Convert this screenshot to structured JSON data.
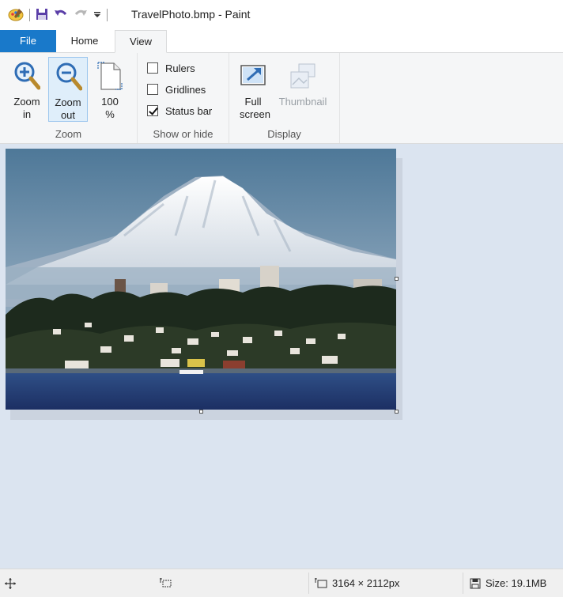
{
  "window": {
    "title": "TravelPhoto.bmp - Paint"
  },
  "quick_access": {
    "icons": [
      "paint-app-icon",
      "save-icon",
      "undo-icon",
      "redo-icon",
      "customize-qat-icon"
    ]
  },
  "tabs": [
    {
      "label": "File"
    },
    {
      "label": "Home"
    },
    {
      "label": "View"
    }
  ],
  "ribbon": {
    "zoom_group": {
      "label": "Zoom",
      "zoom_in": "Zoom in",
      "zoom_out": "Zoom out",
      "hundred": "100 %"
    },
    "show_hide_group": {
      "label": "Show or hide",
      "items": [
        {
          "label": "Rulers",
          "checked": false
        },
        {
          "label": "Gridlines",
          "checked": false
        },
        {
          "label": "Status bar",
          "checked": true
        }
      ]
    },
    "display_group": {
      "label": "Display",
      "full_screen": "Full screen",
      "thumbnail": "Thumbnail"
    }
  },
  "status": {
    "image_dimensions": "3164 × 2112px",
    "file_size": "Size: 19.1MB"
  },
  "colors": {
    "file_tab": "#1979ca",
    "canvas_background": "#dbe4f0"
  }
}
